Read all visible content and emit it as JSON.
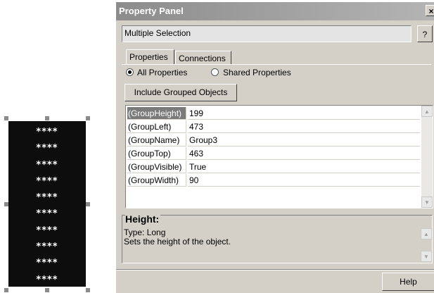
{
  "canvas_object": {
    "rows": [
      "****",
      "****",
      "****",
      "****",
      "****",
      "****",
      "****",
      "****",
      "****",
      "****"
    ]
  },
  "window": {
    "title": "Property Panel",
    "close_label": "×",
    "selection_text": "Multiple Selection",
    "help_question_label": "?",
    "tabs": [
      {
        "label": "Properties",
        "active": true
      },
      {
        "label": "Connections",
        "active": false
      }
    ],
    "filter": {
      "options": [
        {
          "label": "All Properties",
          "checked": true
        },
        {
          "label": "Shared Properties",
          "checked": false
        }
      ]
    },
    "include_button_label": "Include Grouped Objects",
    "properties": [
      {
        "name": "(GroupHeight)",
        "value": "199"
      },
      {
        "name": "(GroupLeft)",
        "value": "473"
      },
      {
        "name": "(GroupName)",
        "value": "Group3"
      },
      {
        "name": "(GroupTop)",
        "value": "463"
      },
      {
        "name": "(GroupVisible)",
        "value": "True"
      },
      {
        "name": "(GroupWidth)",
        "value": "90"
      }
    ],
    "help": {
      "title": "Height:",
      "type_line": "Type: Long",
      "description": "Sets the height of the object."
    },
    "help_button_label": "Help"
  },
  "colors": {
    "dialog_face": "#d4d0c8",
    "title_gradient_start": "#8c8c8c",
    "selected_row": "#7a7a7a",
    "object_fill": "#0d0d0d"
  }
}
